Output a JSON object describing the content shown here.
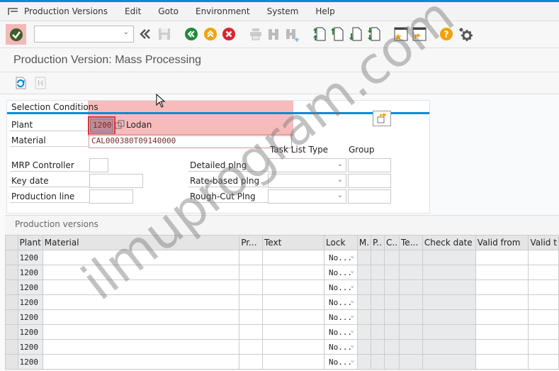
{
  "menubar": {
    "items": [
      "Production Versions",
      "Edit",
      "Goto",
      "Environment",
      "System",
      "Help"
    ]
  },
  "toolbar": {
    "command_field_value": "",
    "buttons": [
      "enter",
      "back-double",
      "save",
      "back",
      "exit",
      "cancel",
      "print",
      "find",
      "find-next",
      "first-page",
      "previous-page",
      "next-page",
      "last-page",
      "create-shortcut",
      "open-shortcut",
      "help",
      "customize"
    ]
  },
  "page": {
    "title": "Production Version: Mass Processing"
  },
  "app_toolbar": {
    "buttons": [
      "refresh",
      "hold"
    ]
  },
  "selection": {
    "title": "Selection Conditions",
    "plant_label": "Plant",
    "plant_value": "1200",
    "plant_desc": "Lodan",
    "material_label": "Material",
    "material_value": "CAL000380T09140000",
    "task_list_type_header": "Task List Type",
    "group_header": "Group",
    "mrp_controller_label": "MRP Controller",
    "mrp_controller_value": "",
    "key_date_label": "Key date",
    "key_date_value": "",
    "production_line_label": "Production line",
    "production_line_value": "",
    "detailed_label": "Detailed plng",
    "rate_based_label": "Rate-based plng",
    "rough_cut_label": "Rough-Cut Plng"
  },
  "production_versions": {
    "title": "Production versions",
    "columns": [
      "Plant",
      "Material",
      "Pr...",
      "Text",
      "Lock",
      "M.",
      "P..",
      "C..",
      "Te...",
      "Check date",
      "Valid from",
      "Valid t"
    ],
    "rows": [
      {
        "plant": "1200",
        "lock": "No..."
      },
      {
        "plant": "1200",
        "lock": "No..."
      },
      {
        "plant": "1200",
        "lock": "No..."
      },
      {
        "plant": "1200",
        "lock": "No..."
      },
      {
        "plant": "1200",
        "lock": "No..."
      },
      {
        "plant": "1200",
        "lock": "No..."
      },
      {
        "plant": "1200",
        "lock": "No..."
      },
      {
        "plant": "1200",
        "lock": "No..."
      }
    ]
  },
  "watermark": "ilmuprogram.com",
  "colors": {
    "accent": "#0a8bd6",
    "highlight": "#f4b8b8",
    "green": "#1f8a3b",
    "orange": "#f0a30a",
    "red": "#d9262c"
  }
}
